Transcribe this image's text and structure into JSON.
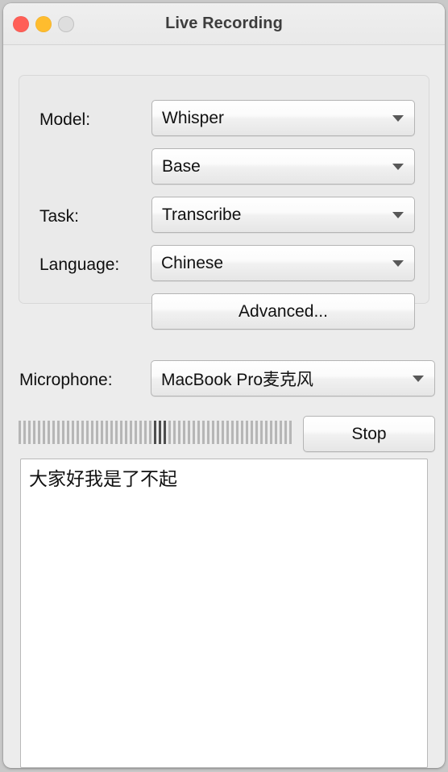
{
  "window": {
    "title": "Live Recording",
    "traffic_lights": [
      {
        "name": "close",
        "color": "#ff5f57"
      },
      {
        "name": "minimize",
        "color": "#febc2e"
      },
      {
        "name": "zoom",
        "color": "#dedede"
      }
    ]
  },
  "settings_group": {
    "model_label": "Model:",
    "model_value": "Whisper",
    "model_size_value": "Base",
    "task_label": "Task:",
    "task_value": "Transcribe",
    "language_label": "Language:",
    "language_value": "Chinese",
    "advanced_button": "Advanced..."
  },
  "microphone": {
    "label": "Microphone:",
    "value": "MacBook Pro麦克风"
  },
  "recording": {
    "stop_button": "Stop",
    "meter": {
      "total_segments": 57,
      "active_indices": [
        28,
        29,
        30
      ],
      "idle_color": "#b6b6b6",
      "active_color": "#4d4d4d"
    }
  },
  "transcript": {
    "text": "大家好我是了不起"
  }
}
